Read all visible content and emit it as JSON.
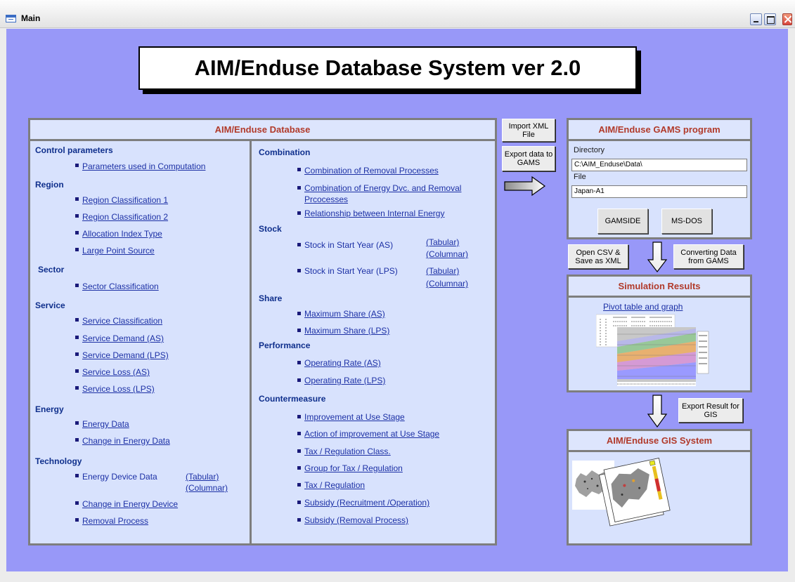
{
  "window": {
    "title": "Main"
  },
  "app_title": "AIM/Enduse Database System ver 2.0",
  "database": {
    "header": "AIM/Enduse Database",
    "left": {
      "control": {
        "label": "Control parameters",
        "items": [
          "Parameters used in Computation"
        ]
      },
      "region": {
        "label": "Region",
        "items": [
          "Region Classification 1",
          "Region Classification 2",
          "Allocation Index Type",
          "Large Point Source"
        ]
      },
      "sector": {
        "label": "Sector",
        "items": [
          "Sector Classification"
        ]
      },
      "service": {
        "label": "Service",
        "items": [
          "Service Classification",
          "Service Demand (AS)",
          "Service Demand (LPS)",
          "Service Loss (AS)",
          "Service Loss (LPS)"
        ]
      },
      "energy": {
        "label": "Energy",
        "items": [
          "Energy Data",
          "Change in Energy Data"
        ]
      },
      "technology": {
        "label": "Technology",
        "device_label": "Energy Device Data",
        "tabular": "(Tabular)",
        "columnar": "(Columnar)",
        "items": [
          "Change in Energy Device",
          "Removal Process"
        ]
      }
    },
    "right": {
      "combination": {
        "label": "Combination",
        "items": [
          "Combination of Removal Processes",
          "Combination of Energy Dvc. and Removal",
          "Prcocesses",
          "Relationship between Internal Energy"
        ]
      },
      "stock": {
        "label": "Stock",
        "as_label": "Stock in Start Year (AS)",
        "lps_label": "Stock in Start Year (LPS)",
        "tabular": "(Tabular)",
        "columnar": "(Columnar)"
      },
      "share": {
        "label": "Share",
        "items": [
          "Maximum Share (AS)",
          "Maximum Share (LPS)"
        ]
      },
      "performance": {
        "label": "Performance",
        "items": [
          "Operating Rate (AS)",
          "Operating Rate (LPS)"
        ]
      },
      "countermeasure": {
        "label": "Countermeasure",
        "items": [
          "Improvement at Use Stage",
          "Action of improvement at Use Stage",
          "Tax / Regulation Class.",
          "Group for Tax / Regulation",
          "Tax / Regulation",
          "Subsidy  (Recruitment /Operation)",
          "Subsidy   (Removal Process)"
        ]
      }
    }
  },
  "middle_buttons": {
    "import": "Import XML File",
    "export": "Export data to GAMS"
  },
  "gams": {
    "header": "AIM/Enduse GAMS program",
    "directory_label": "Directory",
    "directory_value": "C:\\AIM_Enduse\\Data\\",
    "file_label": "File",
    "file_value": "Japan-A1",
    "gamside": "GAMSIDE",
    "msdos": "MS-DOS"
  },
  "csv_buttons": {
    "open": "Open CSV & Save as XML",
    "convert": "Converting Data from GAMS"
  },
  "simulation": {
    "header": "Simulation Results",
    "link": "Pivot table and graph"
  },
  "export_gis": "Export Result for GIS",
  "gis": {
    "header": "AIM/Enduse GIS System"
  }
}
